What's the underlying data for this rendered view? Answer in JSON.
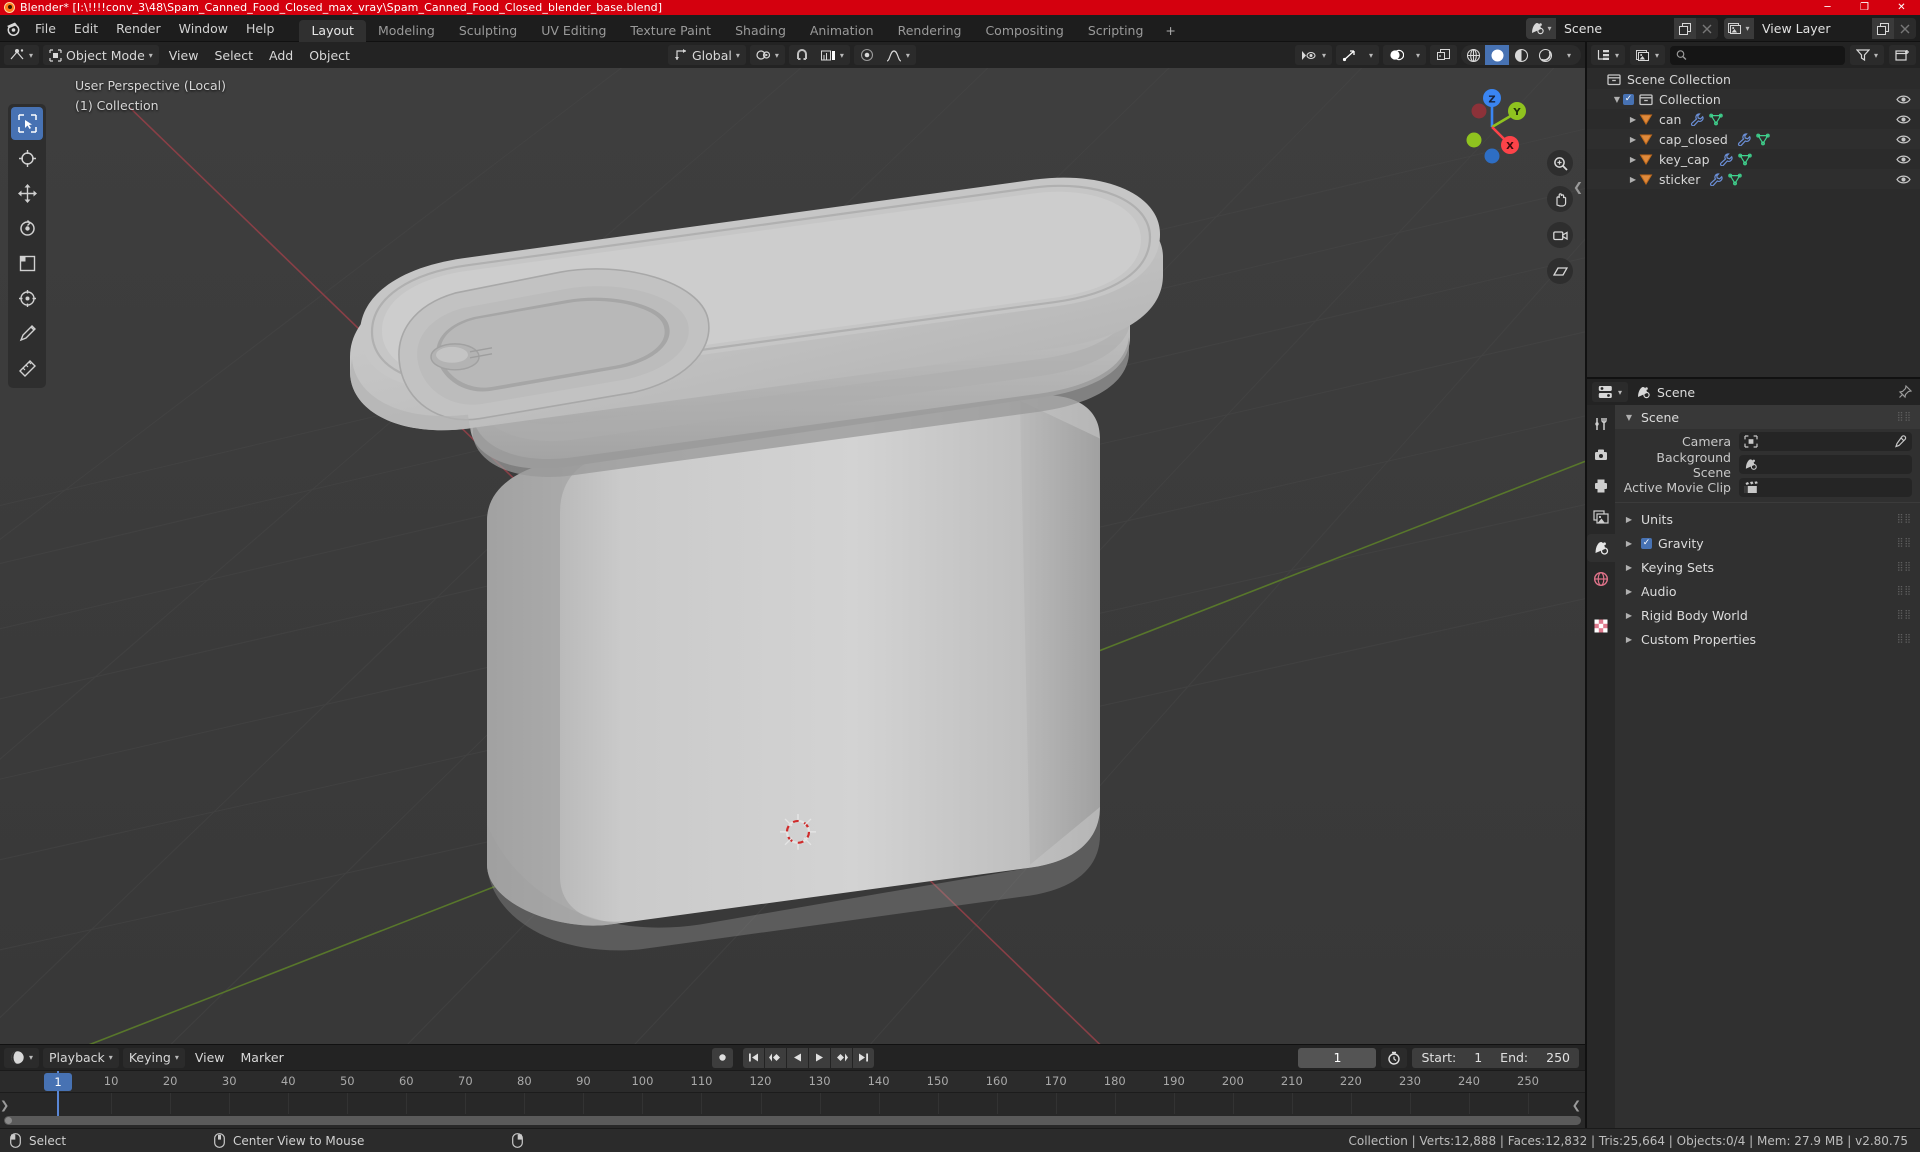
{
  "window": {
    "title": "Blender* [I:\\!!!!conv_3\\48\\Spam_Canned_Food_Closed_max_vray\\Spam_Canned_Food_Closed_blender_base.blend]",
    "min_label": "─",
    "max_label": "❐",
    "close_label": "✕",
    "titlebar_color": "#d4000e"
  },
  "topbar": {
    "menus": [
      "File",
      "Edit",
      "Render",
      "Window",
      "Help"
    ],
    "workspaces": [
      {
        "label": "Layout",
        "active": true
      },
      {
        "label": "Modeling",
        "active": false
      },
      {
        "label": "Sculpting",
        "active": false
      },
      {
        "label": "UV Editing",
        "active": false
      },
      {
        "label": "Texture Paint",
        "active": false
      },
      {
        "label": "Shading",
        "active": false
      },
      {
        "label": "Animation",
        "active": false
      },
      {
        "label": "Rendering",
        "active": false
      },
      {
        "label": "Compositing",
        "active": false
      },
      {
        "label": "Scripting",
        "active": false
      }
    ],
    "add_workspace_label": "+",
    "scene_name": "Scene",
    "view_layer_name": "View Layer"
  },
  "viewport_header": {
    "mode": "Object Mode",
    "menus": [
      "View",
      "Select",
      "Add",
      "Object"
    ],
    "transform_orientation": "Global"
  },
  "viewport": {
    "perspective_label": "User Perspective (Local)",
    "collection_label": "(1) Collection",
    "gizmo_axes": [
      "Z",
      "Y",
      "X"
    ],
    "axis_colors": {
      "x": "#fc4349",
      "y": "#8fc31f",
      "z": "#3a85f2"
    },
    "background_color": "#3b3b3b",
    "object_color": "#c3c3c3"
  },
  "outliner": {
    "search_placeholder": "",
    "rows": [
      {
        "label": "Scene Collection",
        "depth": 0,
        "icon": "collection-icon",
        "expandable": false,
        "checkbox": false,
        "eye": false,
        "obj_icons": []
      },
      {
        "label": "Collection",
        "depth": 1,
        "icon": "collection-icon",
        "expandable": true,
        "checkbox": true,
        "eye": true,
        "obj_icons": []
      },
      {
        "label": "can",
        "depth": 2,
        "icon": "mesh-object-icon",
        "expandable": true,
        "checkbox": false,
        "eye": true,
        "obj_icons": [
          "modifier-icon",
          "mesh-data-icon"
        ]
      },
      {
        "label": "cap_closed",
        "depth": 2,
        "icon": "mesh-object-icon",
        "expandable": true,
        "checkbox": false,
        "eye": true,
        "obj_icons": [
          "modifier-icon",
          "mesh-data-icon"
        ]
      },
      {
        "label": "key_cap",
        "depth": 2,
        "icon": "mesh-object-icon",
        "expandable": true,
        "checkbox": false,
        "eye": true,
        "obj_icons": [
          "modifier-icon",
          "mesh-data-icon"
        ]
      },
      {
        "label": "sticker",
        "depth": 2,
        "icon": "mesh-object-icon",
        "expandable": true,
        "checkbox": false,
        "eye": true,
        "obj_icons": [
          "modifier-icon",
          "mesh-data-icon"
        ]
      }
    ]
  },
  "properties": {
    "breadcrumb": "Scene",
    "panels": [
      {
        "label": "Scene",
        "open": true,
        "checkbox": null
      },
      {
        "label": "Units",
        "open": false,
        "checkbox": null
      },
      {
        "label": "Gravity",
        "open": false,
        "checkbox": true
      },
      {
        "label": "Keying Sets",
        "open": false,
        "checkbox": null
      },
      {
        "label": "Audio",
        "open": false,
        "checkbox": null
      },
      {
        "label": "Rigid Body World",
        "open": false,
        "checkbox": null
      },
      {
        "label": "Custom Properties",
        "open": false,
        "checkbox": null
      }
    ],
    "fields": [
      {
        "label": "Camera",
        "value": "",
        "icon": "camera-icon",
        "eyedropper": true
      },
      {
        "label": "Background Scene",
        "value": "",
        "icon": "scene-icon",
        "eyedropper": false
      },
      {
        "label": "Active Movie Clip",
        "value": "",
        "icon": "clip-icon",
        "eyedropper": false
      }
    ]
  },
  "timeline": {
    "editor_menus": [
      "Playback",
      "Keying",
      "View",
      "Marker"
    ],
    "current_frame": "1",
    "start_label": "Start:",
    "start_value": "1",
    "end_label": "End:",
    "end_value": "250",
    "ticks": [
      "1",
      "10",
      "20",
      "30",
      "40",
      "50",
      "60",
      "70",
      "80",
      "90",
      "100",
      "110",
      "120",
      "130",
      "140",
      "150",
      "160",
      "170",
      "180",
      "190",
      "200",
      "210",
      "220",
      "230",
      "240",
      "250"
    ]
  },
  "statusbar": {
    "left_hints": [
      {
        "icon": "mouse-left-icon",
        "label": "Select"
      },
      {
        "icon": "mouse-middle-icon",
        "label": "Center View to Mouse"
      },
      {
        "icon": "mouse-right-icon",
        "label": ""
      }
    ],
    "stats": "Collection | Verts:12,888 | Faces:12,832 | Tris:25,664 | Objects:0/4 | Mem: 27.9 MB | v2.80.75"
  }
}
